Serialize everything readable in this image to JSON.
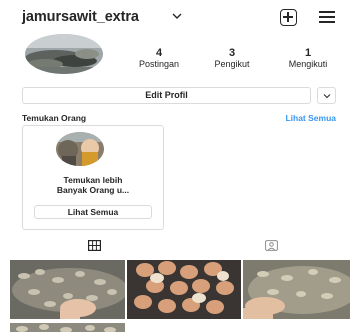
{
  "header": {
    "username": "jamursawit_extra",
    "icons": {
      "account_switch": "chevron-down-icon",
      "create": "plus-square-icon",
      "menu": "hamburger-menu-icon"
    }
  },
  "profile": {
    "stats": [
      {
        "value": "4",
        "label": "Postingan"
      },
      {
        "value": "3",
        "label": "Pengikut"
      },
      {
        "value": "1",
        "label": "Mengikuti"
      }
    ],
    "edit_profile_label": "Edit Profil"
  },
  "discover": {
    "title": "Temukan Orang",
    "see_all": "Lihat Semua",
    "card": {
      "text_line1": "Temukan lebih",
      "text_line2": "Banyak Orang u...",
      "button_label": "Lihat Semua"
    }
  },
  "tabs": [
    {
      "icon": "grid-icon",
      "selected": true
    },
    {
      "icon": "tagged-person-icon",
      "selected": false
    }
  ],
  "colors": {
    "link_blue": "#3897f0",
    "border": "#dbdbdb",
    "text": "#262626"
  },
  "posts_count": 4
}
